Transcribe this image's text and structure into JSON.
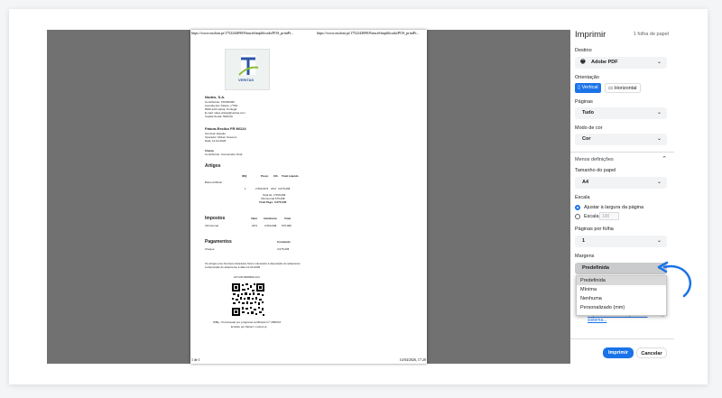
{
  "preview": {
    "header_left": "https://www.moloni.pt/1752244090/FaturaSimplificada/POS_printPr...",
    "header_right": "https://www.moloni.pt/1752244090/FaturaSimplificada/POS_printPr...",
    "footer_left": "1 de 1",
    "footer_right": "14/04/2026, 17:20",
    "logo_text": "VERITAS",
    "company": {
      "name": "Nodes, S.A.",
      "lines": [
        "Contribuinte: 976336495",
        "Avenida dos Tulipos, nº262",
        "5000-123 Lisboa, Portugal",
        "E-mail: vales.visitas@veritas.com",
        "Capital Social: 5000,00"
      ]
    },
    "invoice": {
      "title": "Fatura-Recibo FR M/124",
      "lines": [
        "Terminal: Estúdio",
        "Operador: Rúben Gravens",
        "Data: 14-04-2026"
      ]
    },
    "client": {
      "title": "Cliente",
      "line": "Contribuinte: Consumidor Final"
    },
    "artigos": {
      "title": "Artigos",
      "headers": [
        "IDQ",
        "Preço",
        "IVA",
        "Total Líquido"
      ],
      "item_name": "Bolso Artificial",
      "item_values": [
        "1",
        "2.500,00 €",
        "23%",
        "3.075,00€"
      ],
      "totals": [
        "Total Ilq.   2.500,00€",
        "IVA Normal   575,00€",
        "Total Pago: 3.075,00€"
      ]
    },
    "impostos": {
      "title": "Impostos",
      "headers": [
        "Valor",
        "Incidência",
        "Total"
      ],
      "row_name": "IVA Normal",
      "row_values": [
        "23%",
        "2.500,00€",
        "575,00€"
      ]
    },
    "pagamentos": {
      "title": "Pagamentos",
      "status": "Concluído",
      "row_name": "Cheque",
      "row_value": "3.075,00€"
    },
    "notes": [
      "Os artigos e/ou Serviços faturados foram colocados à disposição do adquirente",
      "à disposição do adquirente à data 14-04-2026"
    ],
    "atcud": "ATCUD:9999999-124",
    "bottom_lines": [
      "W8kj - Processado por programa certificado N.º 2860/AT",
      "Emitido por Moloni | moloni.pt"
    ]
  },
  "panel": {
    "title": "Imprimir",
    "sheet_count": "1 folha de papel",
    "destino_label": "Destino",
    "destino_value": "Adobe PDF",
    "orientacao_label": "Orientação",
    "vertical": "Vertical",
    "horizontal": "Horizontal",
    "paginas_label": "Páginas",
    "paginas_value": "Tudo",
    "cor_label": "Modo de cor",
    "cor_value": "Cor",
    "menos": "Menos definições",
    "tamanho_label": "Tamanho do papel",
    "tamanho_value": "A4",
    "escala_label": "Escala",
    "escala_fit": "Ajustar à largura da página",
    "escala_custom": "Escala",
    "escala_value": "100",
    "ppf_label": "Páginas por folha",
    "ppf_value": "1",
    "margens_label": "Margens",
    "margens_value": "Predefinida",
    "options": [
      "Predefinida",
      "Mínima",
      "Nenhuma",
      "Personalizado (mm)"
    ],
    "system_link_1": "Imprimir utilizando a janela do",
    "system_link_2": "sistema...",
    "print_btn": "Imprimir",
    "cancel_btn": "Cancelar",
    "accent": "#1a73e8"
  }
}
